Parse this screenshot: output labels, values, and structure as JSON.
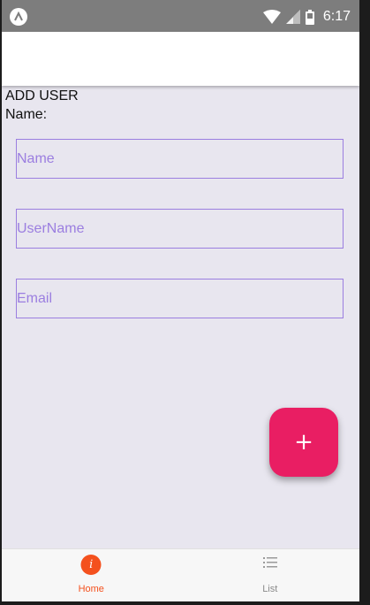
{
  "status_bar": {
    "time": "6:17",
    "icons": [
      "app-notification-icon",
      "wifi-icon",
      "signal-icon",
      "battery-icon"
    ]
  },
  "page": {
    "title": "ADD USER",
    "name_label": "Name:"
  },
  "form": {
    "name_placeholder": "Name",
    "username_placeholder": "UserName",
    "email_placeholder": "Email",
    "accent_color": "#9b7ee0"
  },
  "fab": {
    "label": "+",
    "color": "#e91e63"
  },
  "tabs": [
    {
      "label": "Home",
      "icon": "info-icon",
      "active": true,
      "color": "#f4511e"
    },
    {
      "label": "List",
      "icon": "list-icon",
      "active": false,
      "color": "#8a8a8a"
    }
  ]
}
